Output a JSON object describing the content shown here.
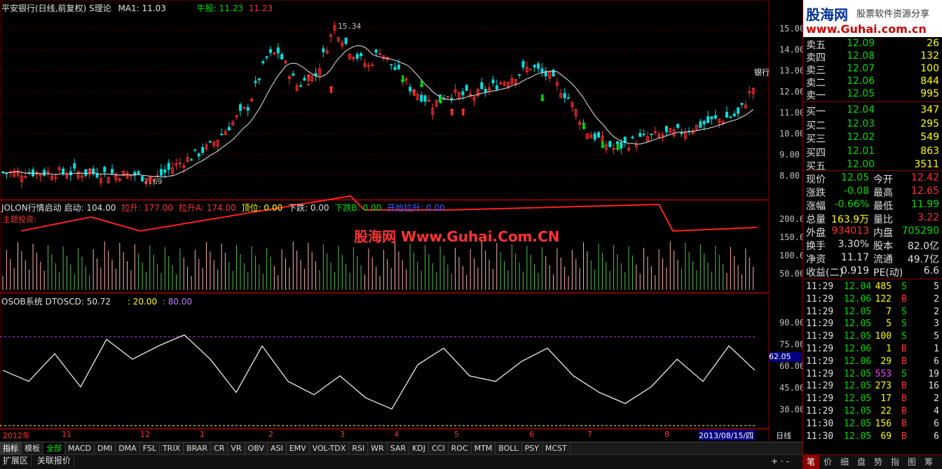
{
  "header": {
    "title": "平安银行(日线,前复权) S理论",
    "ma_label": "MA1: 11.03",
    "bull_label": "牛股: 11.23",
    "bull_value2": "11.23"
  },
  "main_price_axis": [
    "15.00",
    "14.00",
    "13.00",
    "12.00",
    "11.00",
    "10.00",
    "9.00",
    "8.00"
  ],
  "price_annotations": {
    "high": "15.34",
    "low": "7.69",
    "bank_label": "银行"
  },
  "indicator1": {
    "name": "JOLON行情启动",
    "qidong": "启动: 104.00",
    "lasheng": "拉升: 177.00",
    "lashengA": "拉升A: 174.00",
    "dingwei": "顶位: 0.00",
    "xiadie": "下跌: 0.00",
    "xiadieB": "下跌B: 0.00",
    "kaishi": "开始拉升: 0.00",
    "sub_title": "主题投资:",
    "axis": [
      "200.0",
      "150.0",
      "100.0",
      "50.00"
    ]
  },
  "watermark": "股海网 Www.Guhai.Com.CN",
  "indicator2": {
    "name": "OSOB系统",
    "dtoscd": "DTOSCD: 50.72",
    "v20": ": 20.00",
    "v80": ": 80.00",
    "axis": [
      "90.00",
      "75.00",
      "60.00",
      "45.00",
      "30.00"
    ],
    "current_value": "62.05"
  },
  "time_axis": {
    "year_label": "2012年",
    "months": [
      "11",
      "12",
      "1",
      "2",
      "3",
      "4",
      "5",
      "6",
      "7",
      "8"
    ],
    "current_date": "2013/08/15/四",
    "period": "日线"
  },
  "tabs": [
    "指标",
    "模板",
    "全部",
    "MACD",
    "DMI",
    "DMA",
    "FSL",
    "TRIX",
    "BRAR",
    "CR",
    "VR",
    "OBV",
    "ASI",
    "EMV",
    "VOL-TDX",
    "RSI",
    "WR",
    "SAR",
    "KDJ",
    "CCI",
    "ROC",
    "MTM",
    "BOLL",
    "PSY",
    "MCST"
  ],
  "bottom_tabs": [
    "扩展区",
    "关联报价"
  ],
  "logo": {
    "brand": "股海网",
    "slogan": "股票软件资源分享",
    "url": "www.Guhai.com.cn"
  },
  "asks": [
    {
      "label": "卖五",
      "price": "12.09",
      "vol": "26"
    },
    {
      "label": "卖四",
      "price": "12.08",
      "vol": "132"
    },
    {
      "label": "卖三",
      "price": "12.07",
      "vol": "100"
    },
    {
      "label": "卖二",
      "price": "12.06",
      "vol": "844"
    },
    {
      "label": "卖一",
      "price": "12.05",
      "vol": "995"
    }
  ],
  "bids": [
    {
      "label": "买一",
      "price": "12.04",
      "vol": "347"
    },
    {
      "label": "买二",
      "price": "12.03",
      "vol": "295"
    },
    {
      "label": "买三",
      "price": "12.02",
      "vol": "549"
    },
    {
      "label": "买四",
      "price": "12.01",
      "vol": "863"
    },
    {
      "label": "买五",
      "price": "12.00",
      "vol": "3511"
    }
  ],
  "stats": [
    {
      "l1": "现价",
      "v1": "12.05",
      "l2": "今开",
      "v2": "12.42"
    },
    {
      "l1": "涨跌",
      "v1": "-0.08",
      "l2": "最高",
      "v2": "12.65"
    },
    {
      "l1": "涨幅",
      "v1": "-0.66%",
      "l2": "最低",
      "v2": "11.99"
    },
    {
      "l1": "总量",
      "v1": "163.9万",
      "l2": "量比",
      "v2": "3.22"
    },
    {
      "l1": "外盘",
      "v1": "934013",
      "l2": "内盘",
      "v2": "705290"
    },
    {
      "l1": "换手",
      "v1": "3.30%",
      "l2": "股本",
      "v2": "82.0亿"
    },
    {
      "l1": "净资",
      "v1": "11.17",
      "l2": "流通",
      "v2": "49.7亿"
    },
    {
      "l1": "收益(二)",
      "v1": "0.919",
      "l2": "PE(动)",
      "v2": "6.6"
    }
  ],
  "ticks": [
    {
      "t": "11:29",
      "p": "12.04",
      "v": "485",
      "s": "S",
      "n": "5"
    },
    {
      "t": "11:29",
      "p": "12.06",
      "v": "122",
      "s": "B",
      "n": "2"
    },
    {
      "t": "11:29",
      "p": "12.05",
      "v": "7",
      "s": "S",
      "n": "2"
    },
    {
      "t": "11:29",
      "p": "12.05",
      "v": "5",
      "s": "S",
      "n": "3"
    },
    {
      "t": "11:29",
      "p": "12.05",
      "v": "100",
      "s": "S",
      "n": "5"
    },
    {
      "t": "11:29",
      "p": "12.06",
      "v": "1",
      "s": "B",
      "n": "1"
    },
    {
      "t": "11:29",
      "p": "12.06",
      "v": "29",
      "s": "B",
      "n": "6"
    },
    {
      "t": "11:29",
      "p": "12.05",
      "v": "553",
      "s": "S",
      "n": "19"
    },
    {
      "t": "11:29",
      "p": "12.05",
      "v": "273",
      "s": "B",
      "n": "16"
    },
    {
      "t": "11:29",
      "p": "12.05",
      "v": "17",
      "s": "B",
      "n": "2"
    },
    {
      "t": "11:29",
      "p": "12.05",
      "v": "22",
      "s": "B",
      "n": "4"
    },
    {
      "t": "11:30",
      "p": "12.05",
      "v": "156",
      "s": "B",
      "n": "6"
    },
    {
      "t": "11:30",
      "p": "12.05",
      "v": "69",
      "s": "B",
      "n": "6"
    }
  ],
  "right_tabs": [
    "笔",
    "价",
    "细",
    "盘",
    "势",
    "指",
    "图",
    "筹"
  ]
}
